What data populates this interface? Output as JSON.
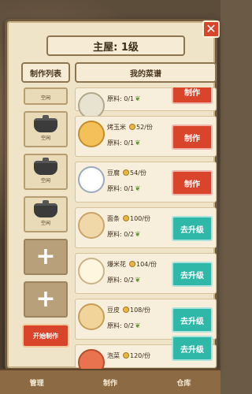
{
  "header": {
    "title": "主屋: 1级"
  },
  "tabs": {
    "left": "制作列表",
    "right": "我的菜谱"
  },
  "queue": {
    "pot_label": "空闲",
    "start_label": "开始制作"
  },
  "recipes": [
    {
      "name": "",
      "price": "",
      "ingredients": "原料: 0/1",
      "button": "制作",
      "food": "bowl",
      "partial": true
    },
    {
      "name": "烤玉米",
      "price": "52/份",
      "ingredients": "原料: 0/1",
      "button": "制作",
      "food": "corn"
    },
    {
      "name": "豆腐",
      "price": "54/份",
      "ingredients": "原料: 0/1",
      "button": "制作",
      "food": "tofu"
    },
    {
      "name": "面条",
      "price": "100/份",
      "ingredients": "原料: 0/2",
      "button": "去升级",
      "food": "noodle"
    },
    {
      "name": "爆米花",
      "price": "104/份",
      "ingredients": "原料: 0/2",
      "button": "去升级",
      "food": "popcorn"
    },
    {
      "name": "豆皮",
      "price": "108/份",
      "ingredients": "原料: 0/2",
      "button": "去升级",
      "food": "dried"
    },
    {
      "name": "泡菜",
      "price": "120/份",
      "ingredients": "",
      "button": "去升级",
      "food": "pickle",
      "partial": true
    }
  ],
  "nav": {
    "manage": "管理",
    "make": "制作",
    "storage": "仓库"
  },
  "icons": {
    "close": "close-icon",
    "coin": "coin-icon",
    "leaf": "ingredient-leaf-icon",
    "pot": "pot-icon",
    "plus": "plus-icon"
  },
  "colors": {
    "make_button": "#d8452b",
    "upgrade_button": "#2fb8a8",
    "panel": "#efe3c8"
  }
}
